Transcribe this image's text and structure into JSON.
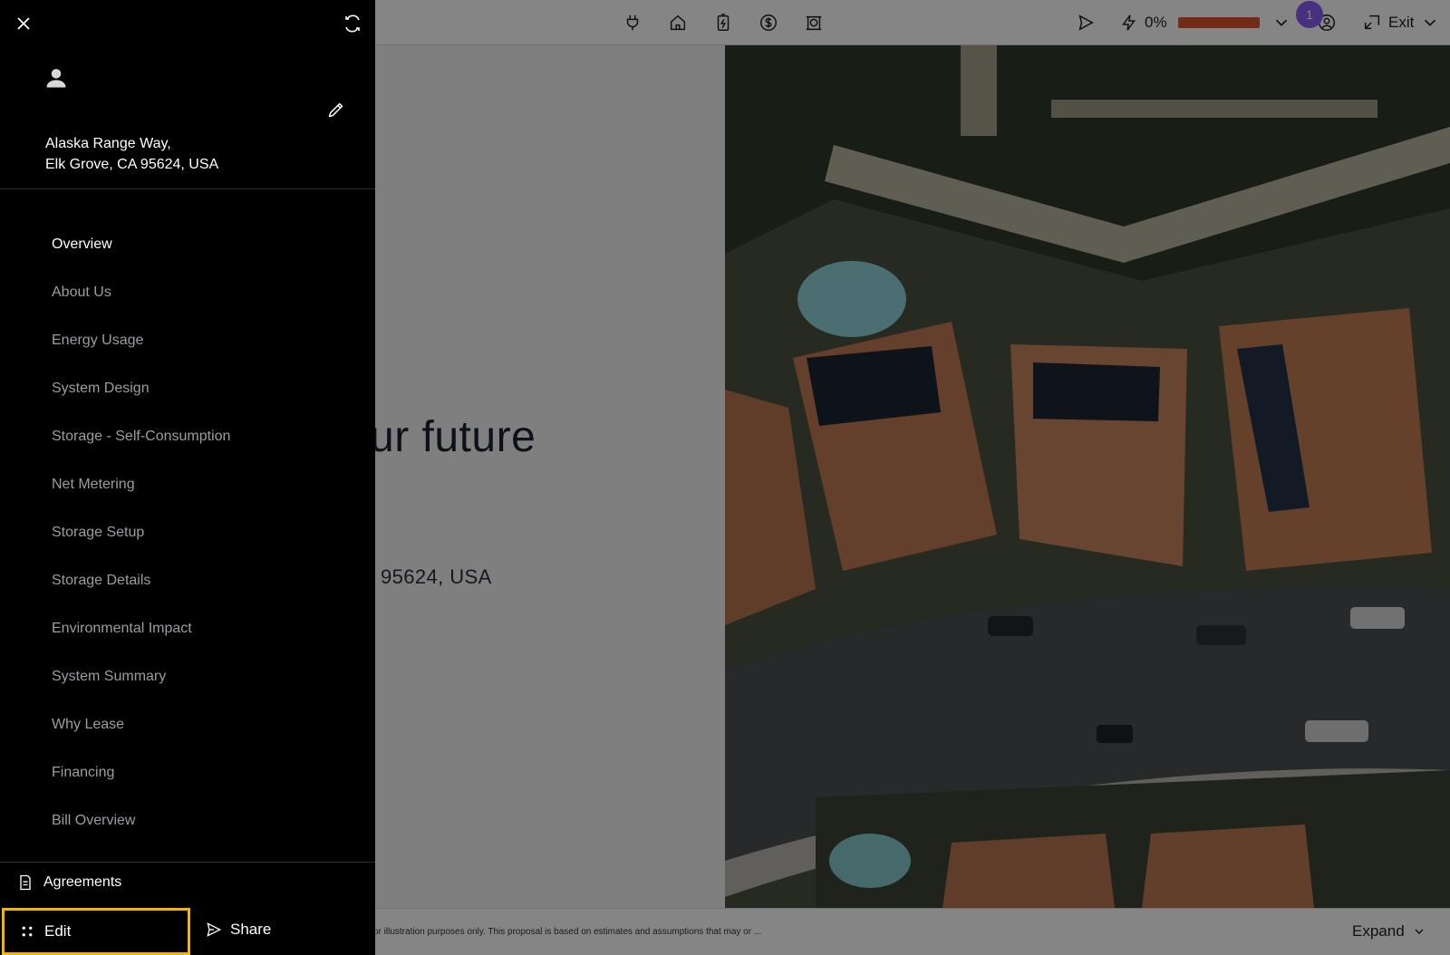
{
  "topbar": {
    "icons": [
      "plug-icon",
      "home-icon",
      "battery-charge-icon",
      "dollar-icon",
      "lease-icon"
    ],
    "right": {
      "send_icon": "send-icon",
      "power_icon": "lightning-icon",
      "power_percent": "0%",
      "power_fill_percent": 100,
      "power_color": "#d9532b",
      "notification_count": "1",
      "exit_label": "Exit"
    }
  },
  "hero": {
    "heading": "ur future",
    "address": "95624, USA"
  },
  "footer": {
    "disclaimer": "or illustration purposes only. This proposal is based on estimates and assumptions that may or ...",
    "expand_label": "Expand"
  },
  "drawer": {
    "address_line1": "Alaska Range Way,",
    "address_line2": "Elk Grove, CA 95624, USA",
    "nav": [
      {
        "label": "Overview",
        "active": true
      },
      {
        "label": "About Us"
      },
      {
        "label": "Energy Usage"
      },
      {
        "label": "System Design"
      },
      {
        "label": "Storage - Self-Consumption"
      },
      {
        "label": "Net Metering"
      },
      {
        "label": "Storage Setup"
      },
      {
        "label": "Storage Details"
      },
      {
        "label": "Environmental Impact"
      },
      {
        "label": "System Summary"
      },
      {
        "label": "Why Lease"
      },
      {
        "label": "Financing"
      },
      {
        "label": "Bill Overview"
      }
    ],
    "agreements_label": "Agreements",
    "edit_label": "Edit",
    "share_label": "Share"
  },
  "colors": {
    "accent_highlight": "#f4b400",
    "badge": "#8b5cf6",
    "drawer_bg": "#000000"
  }
}
